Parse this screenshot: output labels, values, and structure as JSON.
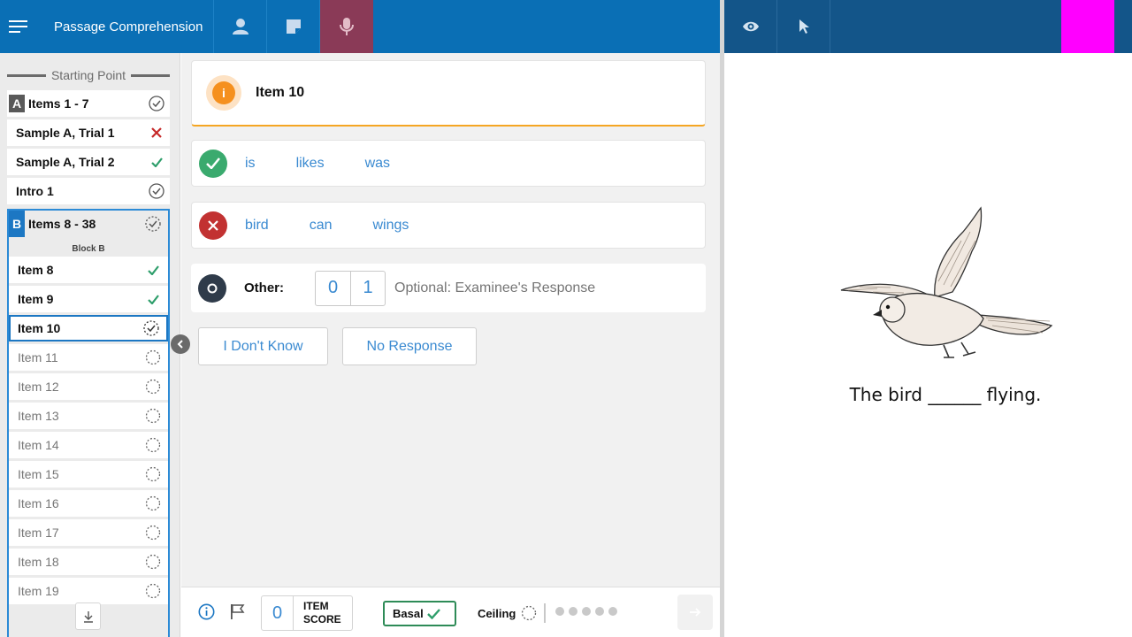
{
  "topbar": {
    "title": "Passage Comprehension",
    "icons": [
      "menu-icon",
      "person-icon",
      "note-icon",
      "microphone-icon"
    ],
    "right_icons": [
      "eye-icon",
      "pointer-icon"
    ],
    "colors": {
      "bar": "#0a6fb5",
      "bar_right": "#135589",
      "mic_active": "#8a3a57",
      "magenta": "#ff00ff"
    }
  },
  "sidebar": {
    "starting_point": "Starting Point",
    "block_a": {
      "badge": "A",
      "label": "Items 1 - 7"
    },
    "items_a": [
      {
        "label": "Sample A, Trial 1",
        "status": "incorrect"
      },
      {
        "label": "Sample A, Trial 2",
        "status": "correct"
      },
      {
        "label": "Intro 1",
        "status": "complete"
      }
    ],
    "block_b": {
      "badge": "B",
      "label": "Items 8 - 38",
      "sub": "Block B"
    },
    "items_b": [
      {
        "label": "Item 8",
        "status": "correct"
      },
      {
        "label": "Item 9",
        "status": "correct"
      },
      {
        "label": "Item 10",
        "status": "current"
      },
      {
        "label": "Item 11",
        "status": "pending"
      },
      {
        "label": "Item 12",
        "status": "pending"
      },
      {
        "label": "Item 13",
        "status": "pending"
      },
      {
        "label": "Item 14",
        "status": "pending"
      },
      {
        "label": "Item 15",
        "status": "pending"
      },
      {
        "label": "Item 16",
        "status": "pending"
      },
      {
        "label": "Item 17",
        "status": "pending"
      },
      {
        "label": "Item 18",
        "status": "pending"
      },
      {
        "label": "Item 19",
        "status": "pending"
      }
    ]
  },
  "main": {
    "item_title": "Item 10",
    "correct_words": [
      "is",
      "likes",
      "was"
    ],
    "incorrect_words": [
      "bird",
      "can",
      "wings"
    ],
    "other": {
      "label": "Other:",
      "score_0": "0",
      "score_1": "1",
      "placeholder": "Optional: Examinee's Response"
    },
    "buttons": {
      "dont_know": "I Don't Know",
      "no_response": "No Response"
    }
  },
  "footer": {
    "item_score_value": "0",
    "item_score_line1": "ITEM",
    "item_score_line2": "SCORE",
    "basal": "Basal",
    "ceiling": "Ceiling"
  },
  "stimulus": {
    "sentence": "The bird ______ flying."
  }
}
